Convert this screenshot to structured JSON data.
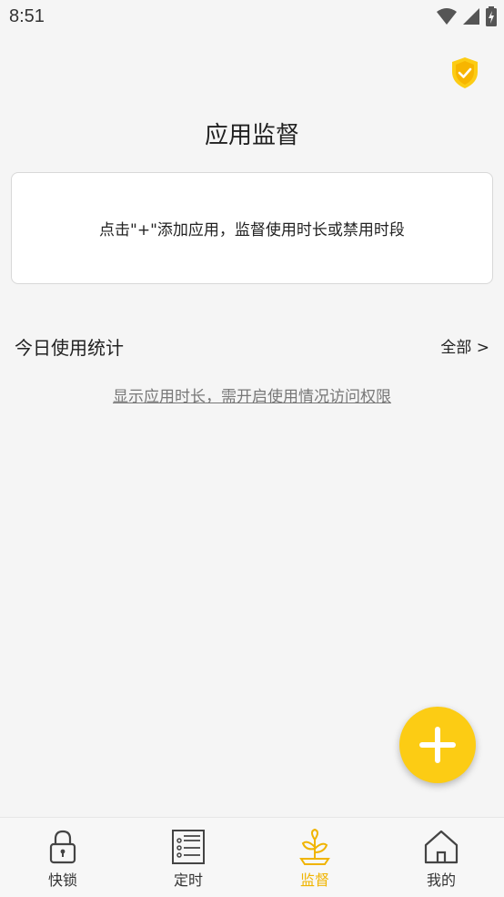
{
  "status_bar": {
    "time": "8:51"
  },
  "header": {
    "title": "应用监督"
  },
  "hint_card": {
    "text": "点击\"+\"添加应用，监督使用时长或禁用时段"
  },
  "stats": {
    "title": "今日使用统计",
    "all_label": "全部 >",
    "permission_text": "显示应用时长，需开启使用情况访问权限"
  },
  "bottom_nav": {
    "items": [
      {
        "label": "快锁",
        "icon": "lock-icon",
        "active": false
      },
      {
        "label": "定时",
        "icon": "list-icon",
        "active": false
      },
      {
        "label": "监督",
        "icon": "sprout-icon",
        "active": true
      },
      {
        "label": "我的",
        "icon": "home-icon",
        "active": false
      }
    ]
  },
  "colors": {
    "accent": "#fccc14",
    "active_label": "#f0b400",
    "background": "#f5f5f5"
  }
}
